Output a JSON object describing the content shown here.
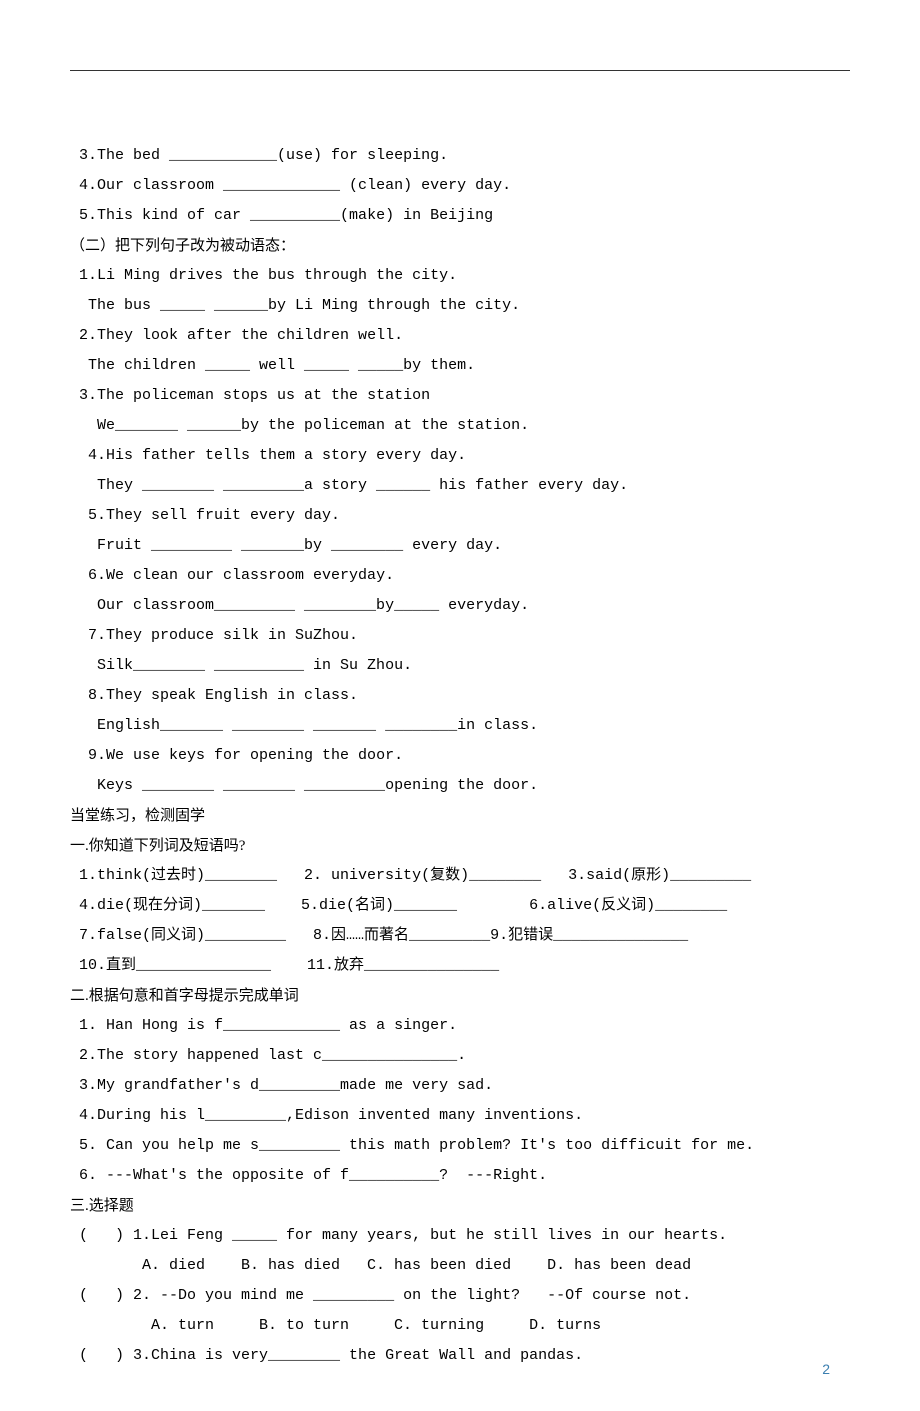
{
  "top_fill": {
    "q3": " 3.The bed ____________(use) for sleeping.",
    "q4": " 4.Our classroom _____________ (clean) every day.",
    "q5": " 5.This kind of car __________(make) in Beijing"
  },
  "section2_heading": "（二）把下列句子改为被动语态：",
  "passive": {
    "q1a": " 1.Li Ming drives the bus through the city.",
    "q1b": "  The bus _____ ______by Li Ming through the city.",
    "q2a": " 2.They look after the children well.",
    "q2b": "  The children _____ well _____ _____by them.",
    "q3a": " 3.The policeman stops us at the station",
    "q3b": "   We_______ ______by the policeman at the station.",
    "q4a": "  4.His father tells them a story every day.",
    "q4b": "   They ________ _________a story ______ his father every day.",
    "q5a": "  5.They sell fruit every day.",
    "q5b": "   Fruit _________ _______by ________ every day.",
    "q6a": "  6.We clean our classroom everyday.",
    "q6b": "   Our classroom_________ ________by_____ everyday.",
    "q7a": "  7.They produce silk in SuZhou.",
    "q7b": "   Silk________ __________ in Su Zhou.",
    "q8a": "  8.They speak English in class.",
    "q8b": "   English_______ ________ _______ ________in class.",
    "q9a": "  9.We use keys for opening the door.",
    "q9b": "   Keys ________ ________ _________opening the door."
  },
  "section3_heading": "当堂练习，检测固学",
  "vocab_heading": "一.你知道下列词及短语吗?",
  "vocab": {
    "l1": " 1.think(过去时)________   2. university(复数)________   3.said(原形)_________",
    "l2": " 4.die(现在分词)_______    5.die(名词)_______        6.alive(反义词)________",
    "l3": " 7.false(同义词)_________   8.因……而著名_________9.犯错误_______________",
    "l4": " 10.直到_______________    11.放弃_______________"
  },
  "complete_heading": "二.根据句意和首字母提示完成单词",
  "complete": {
    "q1": " 1. Han Hong is f_____________ as a singer.",
    "q2": " 2.The story happened last c_______________.",
    "q3": " 3.My grandfather's d_________made me very sad.",
    "q4": " 4.During his l_________,Edison invented many inventions.",
    "q5": " 5. Can you help me s_________ this math problem? It's too difficuit for me.",
    "q6": " 6. ---What's the opposite of f__________?  ---Right."
  },
  "choice_heading": "三.选择题",
  "choice": {
    "q1": " (   ) 1.Lei Feng _____ for many years, but he still lives in our hearts.",
    "q1opts": "        A. died    B. has died   C. has been died    D. has been dead",
    "q2": " (   ) 2. --Do you mind me _________ on the light?   --Of course not.",
    "q2opts": "         A. turn     B. to turn     C. turning     D. turns",
    "q3": " (   ) 3.China is very________ the Great Wall and pandas."
  },
  "page_number": "2"
}
